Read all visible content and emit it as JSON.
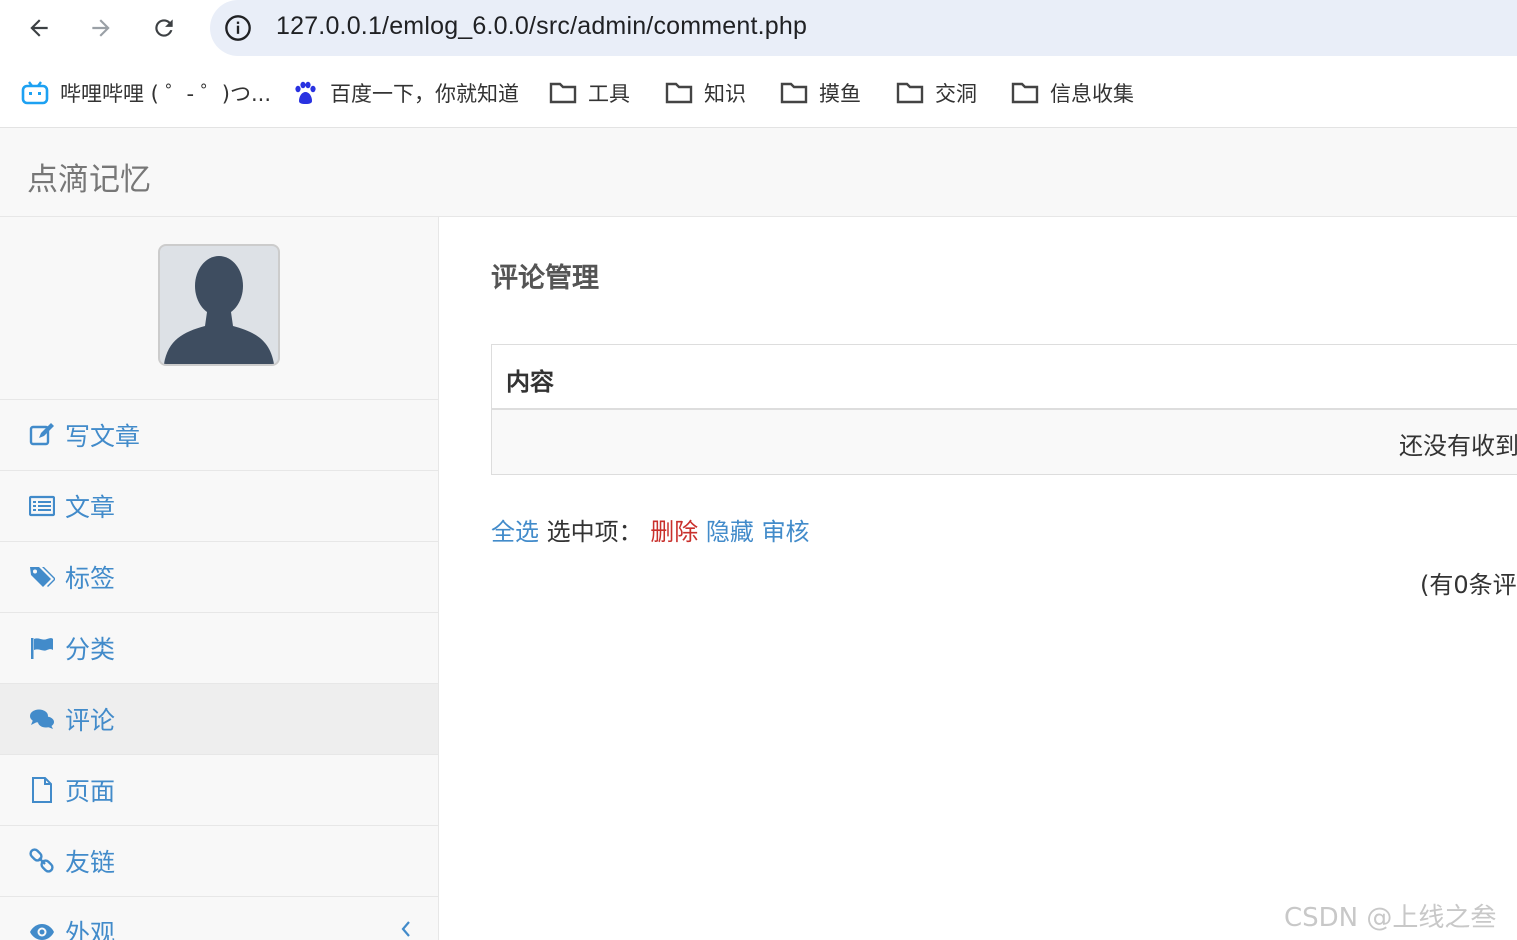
{
  "browser": {
    "url": "127.0.0.1/emlog_6.0.0/src/admin/comment.php",
    "bookmarks": [
      {
        "label": "哔哩哔哩 ( ゜- ゜)つ...",
        "icon": "bilibili-icon"
      },
      {
        "label": "百度一下，你就知道",
        "icon": "baidu-paw-icon"
      },
      {
        "label": "工具",
        "icon": "folder-icon"
      },
      {
        "label": "知识",
        "icon": "folder-icon"
      },
      {
        "label": "摸鱼",
        "icon": "folder-icon"
      },
      {
        "label": "交洞",
        "icon": "folder-icon"
      },
      {
        "label": "信息收集",
        "icon": "folder-icon"
      }
    ]
  },
  "app": {
    "brand": "点滴记忆"
  },
  "sidebar": {
    "items": [
      {
        "label": "写文章",
        "icon": "edit-icon"
      },
      {
        "label": "文章",
        "icon": "list-icon"
      },
      {
        "label": "标签",
        "icon": "tags-icon"
      },
      {
        "label": "分类",
        "icon": "flag-icon"
      },
      {
        "label": "评论",
        "icon": "comments-icon",
        "active": true
      },
      {
        "label": "页面",
        "icon": "file-icon"
      },
      {
        "label": "友链",
        "icon": "link-icon"
      },
      {
        "label": "外观",
        "icon": "eye-icon"
      }
    ]
  },
  "main": {
    "title": "评论管理",
    "table": {
      "header": "内容",
      "empty_text": "还没有收到"
    },
    "actions": {
      "select_all": "全选",
      "selected_label": "选中项：",
      "delete": "删除",
      "hide": "隐藏",
      "approve": "审核"
    },
    "count_text": "(有0条评"
  },
  "watermark": "CSDN @上线之叁",
  "colors": {
    "link": "#428bca",
    "danger": "#c9302c",
    "sidebar_bg": "#f8f8f8",
    "urlbar_bg": "#e9eef8"
  }
}
